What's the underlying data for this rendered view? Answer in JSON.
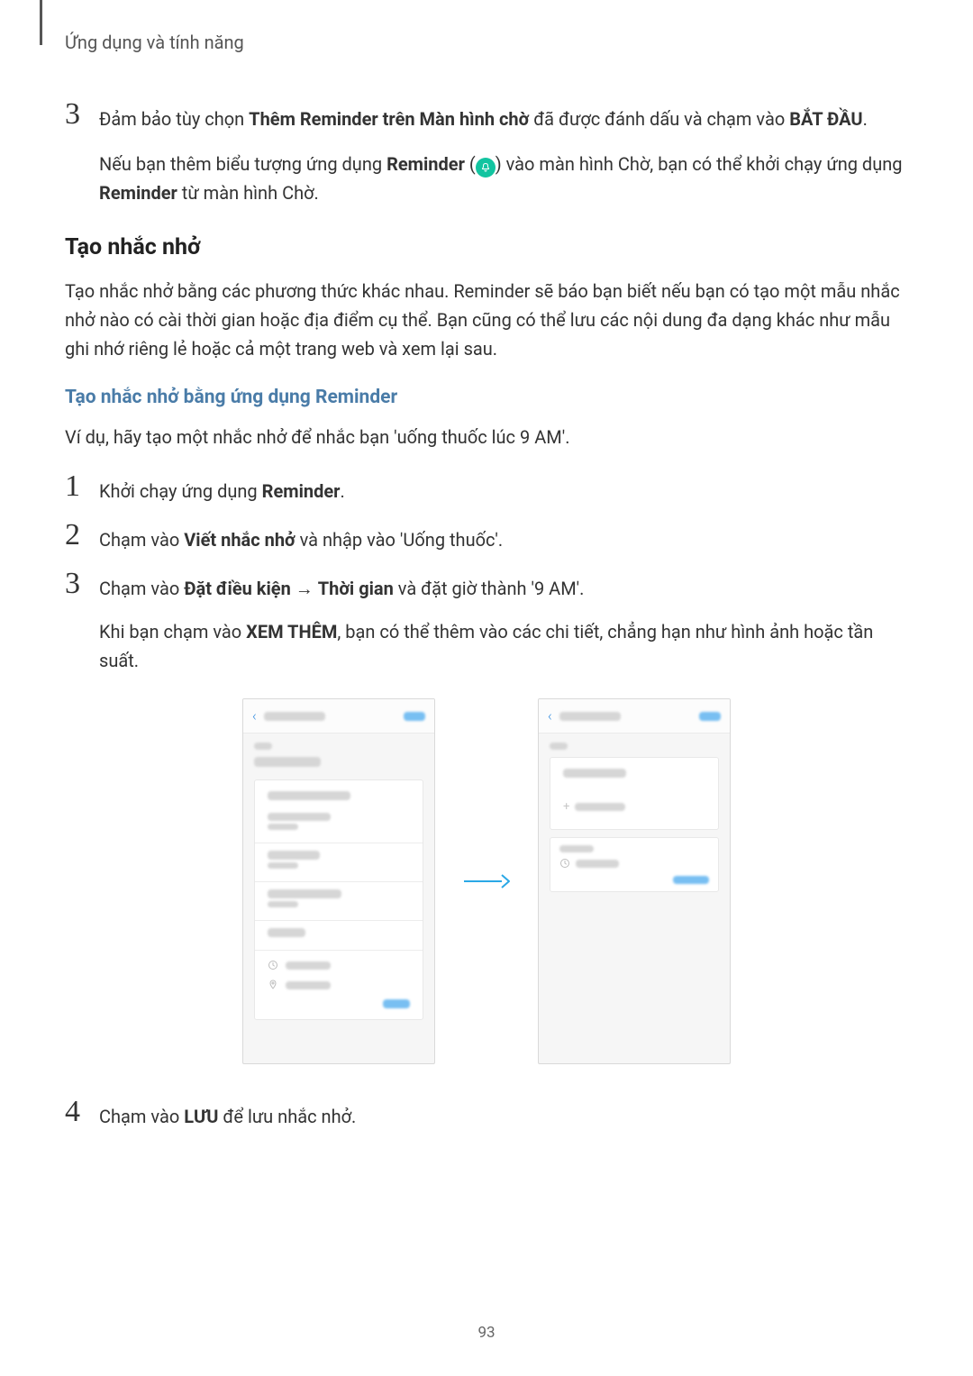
{
  "header": "Ứng dụng và tính năng",
  "step3": {
    "pre": "Đảm bảo tùy chọn ",
    "bold1": "Thêm Reminder trên Màn hình chờ",
    "mid": " đã được đánh dấu và chạm vào ",
    "bold2": "BẮT ĐẦU",
    "suffix": "."
  },
  "step3_note": {
    "p1": "Nếu bạn thêm biểu tượng ứng dụng ",
    "b1": "Reminder",
    "p2": " (",
    "p3": ") vào màn hình Chờ, bạn có thể khởi chạy ứng dụng ",
    "b2": "Reminder",
    "p4": " từ màn hình Chờ."
  },
  "h2": "Tạo nhắc nhở",
  "para1": "Tạo nhắc nhở bằng các phương thức khác nhau. Reminder sẽ báo bạn biết nếu bạn có tạo một mẫu nhắc nhở nào có cài thời gian hoặc địa điểm cụ thể. Bạn cũng có thể lưu các nội dung đa dạng khác như mẫu ghi nhớ riêng lẻ hoặc cả một trang web và xem lại sau.",
  "h3": "Tạo nhắc nhở bằng ứng dụng Reminder",
  "para2": "Ví dụ, hãy tạo một nhắc nhở để nhắc bạn 'uống thuốc lúc 9 AM'.",
  "s1": {
    "pre": "Khởi chạy ứng dụng ",
    "b": "Reminder",
    "suf": "."
  },
  "s2": {
    "pre": "Chạm vào ",
    "b": "Viết nhắc nhở",
    "suf": " và nhập vào 'Uống thuốc'."
  },
  "s3": {
    "pre": "Chạm vào ",
    "b1": "Đặt điều kiện",
    "mid": " → ",
    "b2": "Thời gian",
    "suf": " và đặt giờ thành '9 AM'."
  },
  "s3_note": {
    "pre": "Khi bạn chạm vào ",
    "b": "XEM THÊM",
    "suf": ", bạn có thể thêm vào các chi tiết, chẳng hạn như hình ảnh hoặc tần suất."
  },
  "s4": {
    "pre": "Chạm vào ",
    "b": "LƯU",
    "suf": " để lưu nhắc nhở."
  },
  "numbers": {
    "n1": "1",
    "n2": "2",
    "n3": "3",
    "n4": "4"
  },
  "page_number": "93",
  "icon_names": {
    "bell": "reminder-bell-icon",
    "arrow": "flow-arrow-icon",
    "back": "back-chevron-icon",
    "clock": "clock-icon",
    "pin": "location-pin-icon"
  }
}
